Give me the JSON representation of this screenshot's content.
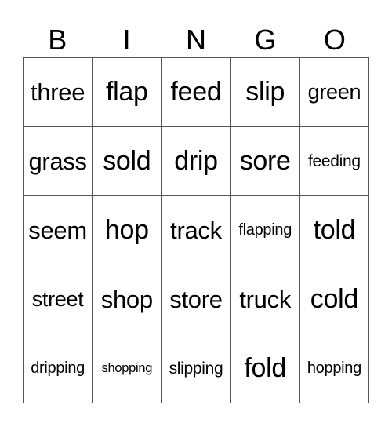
{
  "header": [
    "B",
    "I",
    "N",
    "G",
    "O"
  ],
  "cells": [
    [
      "three",
      "flap",
      "feed",
      "slip",
      "green"
    ],
    [
      "grass",
      "sold",
      "drip",
      "sore",
      "feeding"
    ],
    [
      "seem",
      "hop",
      "track",
      "flapping",
      "told"
    ],
    [
      "street",
      "shop",
      "store",
      "truck",
      "cold"
    ],
    [
      "dripping",
      "shopping",
      "slipping",
      "fold",
      "hopping"
    ]
  ]
}
